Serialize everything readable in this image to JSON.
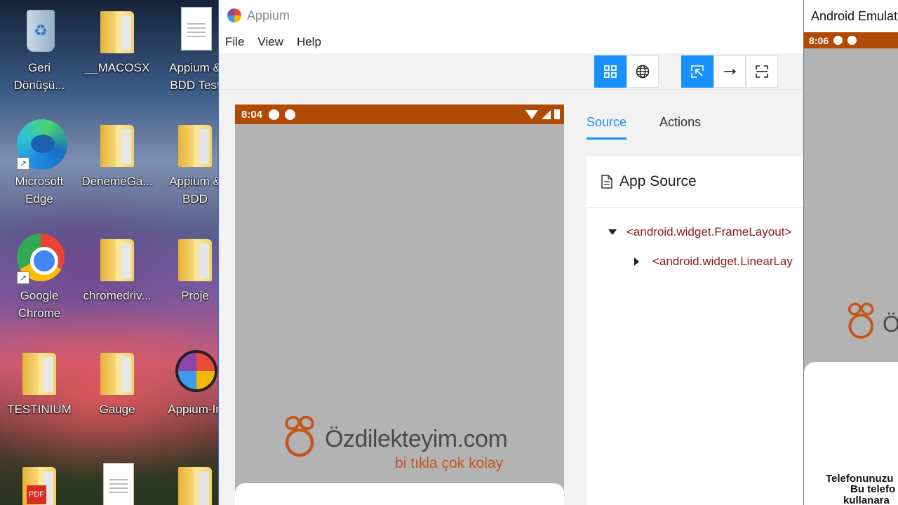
{
  "desktop": {
    "icons": [
      {
        "label": "Geri Dönüşü..."
      },
      {
        "label": "__MACOSX"
      },
      {
        "label": "Appium & BDD Test"
      },
      {
        "label": "Microsoft Edge"
      },
      {
        "label": "DenemeGa..."
      },
      {
        "label": "Appium & BDD"
      },
      {
        "label": "Google Chrome"
      },
      {
        "label": "chromedriv..."
      },
      {
        "label": "Proje"
      },
      {
        "label": "TESTINIUM"
      },
      {
        "label": "Gauge"
      },
      {
        "label": "Appium-In"
      }
    ]
  },
  "appium": {
    "title": "Appium",
    "menu": [
      "File",
      "View",
      "Help"
    ],
    "toolbar": {
      "buttons": [
        "native-app-mode",
        "web-context-mode",
        "select-elements",
        "swipe-by-coordinates",
        "tap-by-coordinates"
      ]
    },
    "device": {
      "time": "8:04",
      "brand_name": "Özdilekteyim.com",
      "brand_tagline": "bi tıkla çok kolay"
    },
    "tabs": [
      "Source",
      "Actions"
    ],
    "active_tab": "Source",
    "source": {
      "title": "App Source",
      "nodes": [
        "<android.widget.FrameLayout>",
        "<android.widget.LinearLay"
      ]
    }
  },
  "emulator": {
    "title": "Android Emulat",
    "time": "8:06",
    "brand_char": "Ö",
    "sheet_lines": [
      "Telefonunuzu",
      "Bu telefo",
      "kullanara"
    ]
  },
  "colors": {
    "accent": "#1890ff",
    "status_bar": "#b14a05",
    "brand_orange": "#c4561b",
    "tree_tag": "#8b1a1a"
  }
}
